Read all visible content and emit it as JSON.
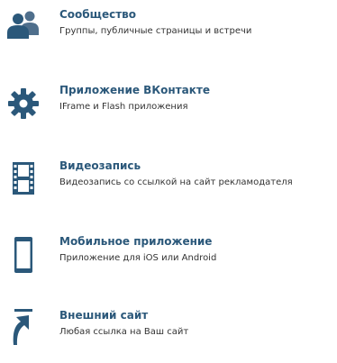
{
  "colors": {
    "icon": "#2b587a",
    "title": "#2b587a",
    "description": "#333333",
    "background": "#ffffff"
  },
  "items": [
    {
      "icon": "community-icon",
      "title": "Сообщество",
      "description": "Группы, публичные страницы и встречи"
    },
    {
      "icon": "gear-icon",
      "title": "Приложение ВКонтакте",
      "description": "IFrame и Flash приложения"
    },
    {
      "icon": "film-strip-icon",
      "title": "Видеозапись",
      "description": "Видеозапись со ссылкой на сайт рекламодателя"
    },
    {
      "icon": "mobile-phone-icon",
      "title": "Мобильное приложение",
      "description": "Приложение для iOS или Android"
    },
    {
      "icon": "external-link-arrow-icon",
      "title": "Внешний сайт",
      "description": "Любая ссылка на Ваш сайт"
    }
  ]
}
